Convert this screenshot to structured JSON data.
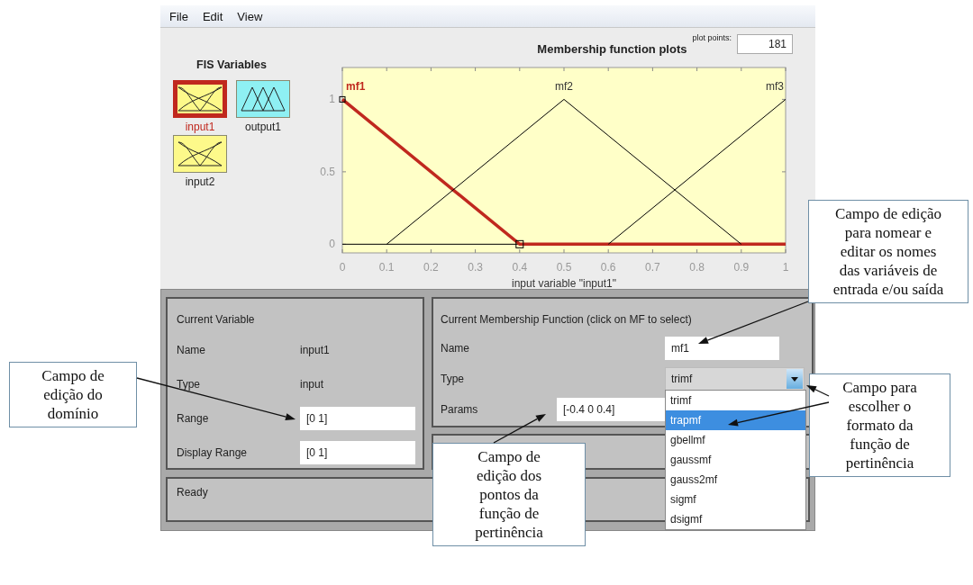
{
  "menu": [
    "File",
    "Edit",
    "View"
  ],
  "fis_variables": {
    "title": "FIS Variables",
    "items": [
      {
        "label": "input1",
        "kind": "input",
        "selected": true
      },
      {
        "label": "output1",
        "kind": "output",
        "selected": false
      },
      {
        "label": "input2",
        "kind": "input",
        "selected": false
      }
    ]
  },
  "plot": {
    "plot_points_label": "plot points:",
    "plot_points": "181",
    "chart_data": {
      "type": "line",
      "title": "Membership function plots",
      "xlabel": "input variable \"input1\"",
      "x": [
        0,
        0.1,
        0.4,
        0.5,
        0.6,
        0.9,
        1
      ],
      "series": [
        {
          "name": "mf1",
          "color": "#c0281e",
          "values": [
            1,
            0.75,
            0,
            0,
            0,
            0,
            0
          ]
        },
        {
          "name": "mf2",
          "color": "#000000",
          "values": [
            null,
            0,
            0.75,
            1,
            0.75,
            0,
            null
          ]
        },
        {
          "name": "mf3",
          "color": "#000000",
          "values": [
            null,
            null,
            null,
            null,
            0,
            0.75,
            1
          ]
        }
      ],
      "xlim": [
        0,
        1
      ],
      "ylim": [
        -0.06,
        1.22
      ],
      "xticks": [
        0,
        0.1,
        0.2,
        0.3,
        0.4,
        0.5,
        0.6,
        0.7,
        0.8,
        0.9,
        1
      ],
      "yticks": [
        0,
        0.5,
        1
      ]
    }
  },
  "current_variable": {
    "title": "Current Variable",
    "rows": [
      {
        "label": "Name",
        "value": "input1",
        "kind": "text"
      },
      {
        "label": "Type",
        "value": "input",
        "kind": "text"
      },
      {
        "label": "Range",
        "value": "[0 1]",
        "kind": "field"
      },
      {
        "label": "Display Range",
        "value": "[0 1]",
        "kind": "field"
      }
    ]
  },
  "current_mf": {
    "title": "Current Membership Function (click on MF to select)",
    "name_label": "Name",
    "name": "mf1",
    "type_label": "Type",
    "type": "trimf",
    "expanded": true,
    "params_label": "Params",
    "params": "[-0.4 0 0.4]",
    "type_options": [
      {
        "label": "trimf",
        "selected": false
      },
      {
        "label": "trapmf",
        "selected": true
      },
      {
        "label": "gbellmf",
        "selected": false
      },
      {
        "label": "gaussmf",
        "selected": false
      },
      {
        "label": "gauss2mf",
        "selected": false
      },
      {
        "label": "sigmf",
        "selected": false
      },
      {
        "label": "dsigmf",
        "selected": false
      }
    ]
  },
  "status": "Ready",
  "callouts": [
    {
      "text": "Campo de edição do domínio"
    },
    {
      "text": "Campo de edição para nomear e editar os nomes das variáveis de entrada e/ou saída"
    },
    {
      "text": "Campo para escolher o formato da função de pertinência"
    },
    {
      "text": "Campo de edição dos pontos da função de pertinência"
    }
  ]
}
